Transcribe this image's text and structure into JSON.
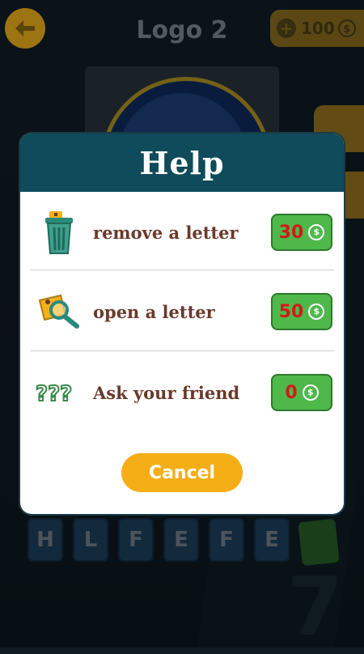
{
  "header": {
    "title": "Logo 2",
    "coins_amount": "100",
    "coin_symbol": "$"
  },
  "letters": [
    "H",
    "L",
    "F",
    "E",
    "F",
    "E"
  ],
  "dialog": {
    "title": "Help",
    "options": [
      {
        "label": "remove a letter",
        "price": "30",
        "icon": "trash-can-icon"
      },
      {
        "label": "open a letter",
        "price": "50",
        "icon": "magnifier-key-icon"
      },
      {
        "label": "Ask your friend",
        "price": "0",
        "icon": "question-marks-icon"
      }
    ],
    "coin_symbol": "$",
    "cancel_label": "Cancel"
  },
  "colors": {
    "accent_yellow": "#f2b21c",
    "header_teal": "#0f4b5a",
    "price_green": "#4eb84a",
    "price_red": "#d21a1a",
    "label_brown": "#6a3a2a"
  }
}
